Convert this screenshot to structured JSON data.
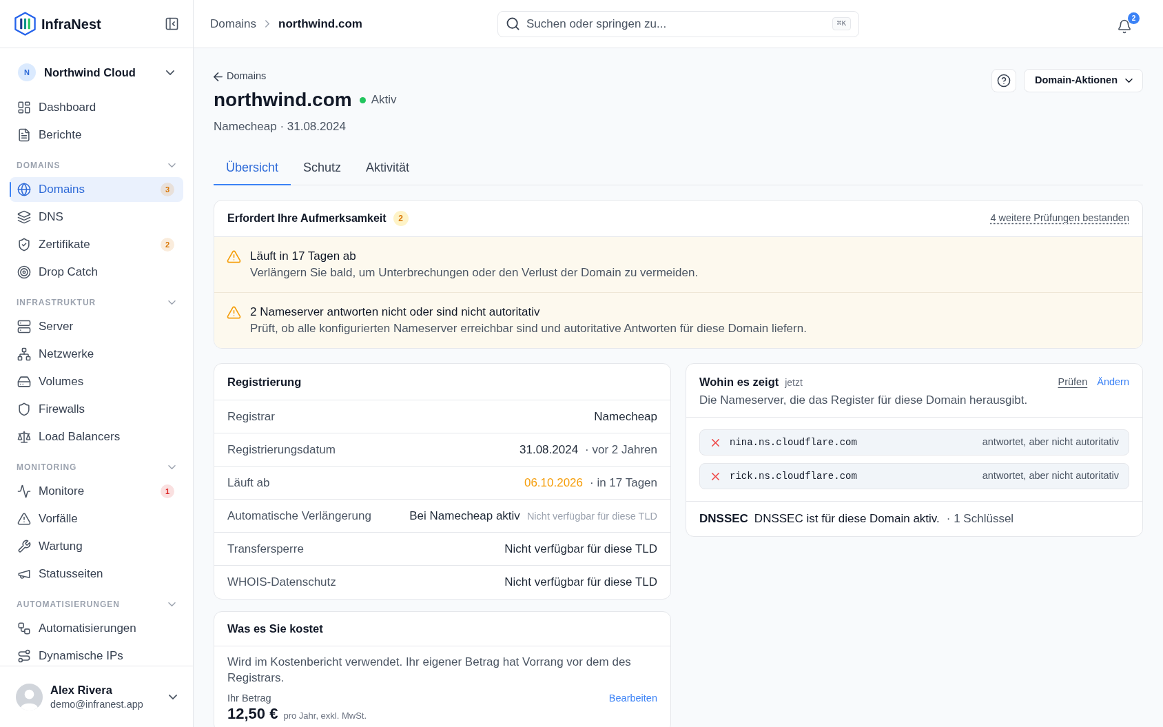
{
  "app": {
    "name": "InfraNest"
  },
  "workspace": {
    "initial": "N",
    "name": "Northwind Cloud"
  },
  "sidebar": {
    "items": [
      {
        "label": "Dashboard",
        "selected": false
      },
      {
        "label": "Berichte",
        "selected": false
      }
    ],
    "sections": [
      {
        "title": "DOMAINS",
        "expanded": true,
        "items": [
          {
            "label": "Domains",
            "selected": true,
            "badge": "3",
            "color": "#d97706"
          },
          {
            "label": "DNS",
            "selected": false
          },
          {
            "label": "Zertifikate",
            "selected": false,
            "badge": "2",
            "color": "#d97706"
          },
          {
            "label": "Drop Catch",
            "selected": false
          }
        ]
      },
      {
        "title": "INFRASTRUKTUR",
        "expanded": true,
        "items": [
          {
            "label": "Server",
            "selected": false
          },
          {
            "label": "Netzwerke",
            "selected": false
          },
          {
            "label": "Volumes",
            "selected": false
          },
          {
            "label": "Firewalls",
            "selected": false
          },
          {
            "label": "Load Balancers",
            "selected": false
          }
        ]
      },
      {
        "title": "MONITORING",
        "expanded": true,
        "items": [
          {
            "label": "Monitore",
            "selected": false,
            "badge": "1",
            "color": "#dc2626"
          },
          {
            "label": "Vorfälle",
            "selected": false
          },
          {
            "label": "Wartung",
            "selected": false
          },
          {
            "label": "Statusseiten",
            "selected": false
          }
        ]
      },
      {
        "title": "AUTOMATISIERUNGEN",
        "expanded": true,
        "items": [
          {
            "label": "Automatisierungen",
            "selected": false
          },
          {
            "label": "Dynamische IPs",
            "selected": false
          }
        ]
      }
    ]
  },
  "user": {
    "name": "Alex Rivera",
    "email": "demo@infranest.app"
  },
  "header": {
    "breadcrumbs": [
      {
        "label": "Domains",
        "current": false
      },
      {
        "label": "northwind.com",
        "current": true
      }
    ],
    "search": {
      "placeholder": "Suchen oder springen zu...",
      "shortcut": "⌘K"
    },
    "notifications": {
      "count": "2"
    }
  },
  "page": {
    "back_link": "Domains",
    "title": "northwind.com",
    "status": {
      "label": "Aktiv",
      "active": true
    },
    "subtitle": "Namecheap · 31.08.2024",
    "actions_button": "Domain-Aktionen"
  },
  "tabs": [
    {
      "label": "Übersicht",
      "selected": true
    },
    {
      "label": "Schutz",
      "selected": false
    },
    {
      "label": "Aktivität",
      "selected": false
    }
  ],
  "attention": {
    "title": "Erfordert Ihre Aufmerksamkeit",
    "count": "2",
    "passed_link": "4 weitere Prüfungen bestanden",
    "items": [
      {
        "title": "Läuft in 17 Tagen ab",
        "description": "Verlängern Sie bald, um Unterbrechungen oder den Verlust der Domain zu vermeiden."
      },
      {
        "title": "2 Nameserver antworten nicht oder sind nicht autoritativ",
        "description": "Prüft, ob alle konfigurierten Nameserver erreichbar sind und autoritative Antworten für diese Domain liefern."
      }
    ]
  },
  "registration": {
    "title": "Registrierung",
    "rows": [
      {
        "label": "Registrar",
        "value": "Namecheap",
        "warning": false
      },
      {
        "label": "Registrierungsdatum",
        "value": "31.08.2024",
        "warning": false,
        "note": "· vor 2 Jahren"
      },
      {
        "label": "Läuft ab",
        "value": "06.10.2026",
        "warning": true,
        "note": "· in 17 Tagen"
      },
      {
        "label": "Automatische Verlängerung",
        "value": "Bei Namecheap aktiv",
        "warning": false,
        "hint": "Nicht verfügbar für diese TLD"
      },
      {
        "label": "Transfersperre",
        "value": "Nicht verfügbar für diese TLD",
        "warning": false
      },
      {
        "label": "WHOIS-Datenschutz",
        "value": "Nicht verfügbar für diese TLD",
        "warning": false
      }
    ]
  },
  "cost": {
    "title": "Was es Sie kostet",
    "description": "Wird im Kostenbericht verwendet. Ihr eigener Betrag hat Vorrang vor dem des Registrars.",
    "amount_label": "Ihr Betrag",
    "edit_link": "Bearbeiten",
    "amount": "12,50 €",
    "amount_note": "pro Jahr, exkl. MwSt."
  },
  "nameservers": {
    "title": "Wohin es zeigt",
    "updated": "jetzt",
    "description": "Die Nameserver, die das Register für diese Domain herausgibt.",
    "actions": [
      {
        "label": "Prüfen",
        "kind": "secondary"
      },
      {
        "label": "Ändern",
        "kind": "primary"
      }
    ],
    "servers": [
      {
        "host": "nina.ns.cloudflare.com",
        "status": "antwortet, aber nicht autoritativ",
        "ok": false
      },
      {
        "host": "rick.ns.cloudflare.com",
        "status": "antwortet, aber nicht autoritativ",
        "ok": false
      }
    ],
    "dnssec": {
      "label": "DNSSEC",
      "text": "DNSSEC ist für diese Domain aktiv.",
      "note": "· 1 Schlüssel"
    }
  }
}
